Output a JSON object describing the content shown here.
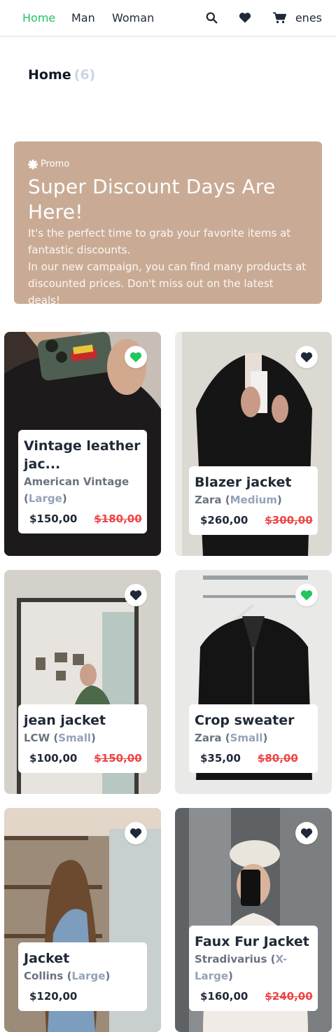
{
  "nav": {
    "links": [
      "Home",
      "Man",
      "Woman"
    ],
    "user": "enes",
    "icons": [
      "search-icon",
      "heart-icon",
      "cart-icon"
    ],
    "accent": "#22c55e"
  },
  "page": {
    "title": "Home",
    "count": "(6)"
  },
  "promo": {
    "tag": "Promo",
    "title": "Super Discount Days Are Here!",
    "line1": "It's the perfect time to grab your favorite items at fantastic discounts.",
    "line2": "In our new campaign, you can find many products at discounted prices. Don't miss out on the latest deals!",
    "color": "#c9ab95"
  },
  "products": [
    {
      "name": "Vintage leather jac...",
      "brand": "American Vintage",
      "size": "Large",
      "price": "$150,00",
      "old_price": "$180,00",
      "favorite": true
    },
    {
      "name": "Blazer jacket",
      "brand": "Zara",
      "size": "Medium",
      "price": "$260,00",
      "old_price": "$300,00",
      "favorite": false
    },
    {
      "name": "jean jacket",
      "brand": "LCW",
      "size": "Small",
      "price": "$100,00",
      "old_price": "$150,00",
      "favorite": false
    },
    {
      "name": "Crop sweater",
      "brand": "Zara",
      "size": "Small",
      "price": "$35,00",
      "old_price": "$80,00",
      "favorite": true
    },
    {
      "name": "Jacket",
      "brand": "Collins",
      "size": "Large",
      "price": "$120,00",
      "old_price": "",
      "favorite": false
    },
    {
      "name": "Faux Fur Jacket",
      "brand": "Stradivarius",
      "size": "X-Large",
      "price": "$160,00",
      "old_price": "$240,00",
      "favorite": false
    }
  ]
}
